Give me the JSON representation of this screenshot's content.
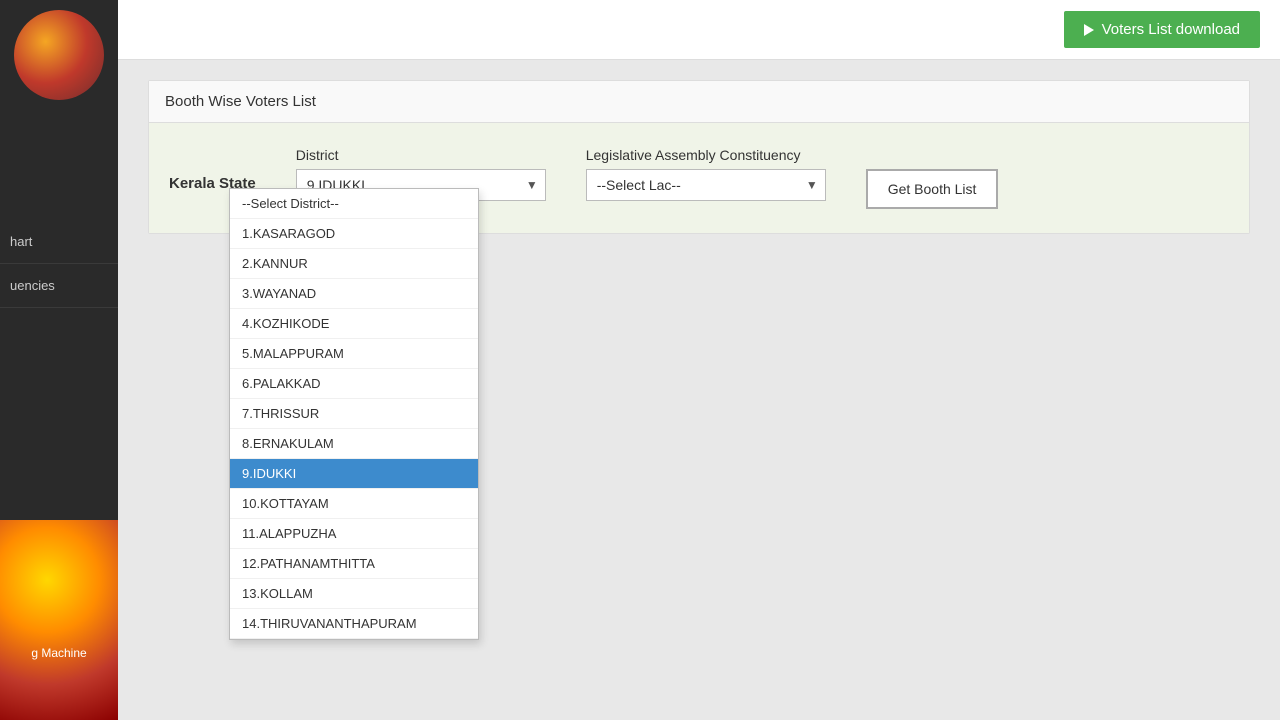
{
  "sidebar": {
    "items": [
      {
        "label": "hart",
        "id": "chart"
      },
      {
        "label": "uencies",
        "id": "frequencies"
      },
      {
        "label": "g Machine",
        "id": "machine"
      }
    ]
  },
  "topbar": {
    "voters_btn_label": "Voters List download"
  },
  "section": {
    "title": "Booth Wise Voters List"
  },
  "form": {
    "state_label": "Kerala State",
    "district_label": "District",
    "district_placeholder": "--Select District--",
    "lac_label": "Legislative Assembly Constituency",
    "lac_placeholder": "--Select Lac--",
    "get_booth_label": "Get Booth List"
  },
  "dropdown": {
    "items": [
      {
        "label": "--Select District--",
        "value": "",
        "selected": false
      },
      {
        "label": "1.KASARAGOD",
        "value": "1",
        "selected": false
      },
      {
        "label": "2.KANNUR",
        "value": "2",
        "selected": false
      },
      {
        "label": "3.WAYANAD",
        "value": "3",
        "selected": false
      },
      {
        "label": "4.KOZHIKODE",
        "value": "4",
        "selected": false
      },
      {
        "label": "5.MALAPPURAM",
        "value": "5",
        "selected": false
      },
      {
        "label": "6.PALAKKAD",
        "value": "6",
        "selected": false
      },
      {
        "label": "7.THRISSUR",
        "value": "7",
        "selected": false
      },
      {
        "label": "8.ERNAKULAM",
        "value": "8",
        "selected": false
      },
      {
        "label": "9.IDUKKI",
        "value": "9",
        "selected": true
      },
      {
        "label": "10.KOTTAYAM",
        "value": "10",
        "selected": false
      },
      {
        "label": "11.ALAPPUZHA",
        "value": "11",
        "selected": false
      },
      {
        "label": "12.PATHANAMTHITTA",
        "value": "12",
        "selected": false
      },
      {
        "label": "13.KOLLAM",
        "value": "13",
        "selected": false
      },
      {
        "label": "14.THIRUVANANTHAPURAM",
        "value": "14",
        "selected": false
      }
    ]
  }
}
